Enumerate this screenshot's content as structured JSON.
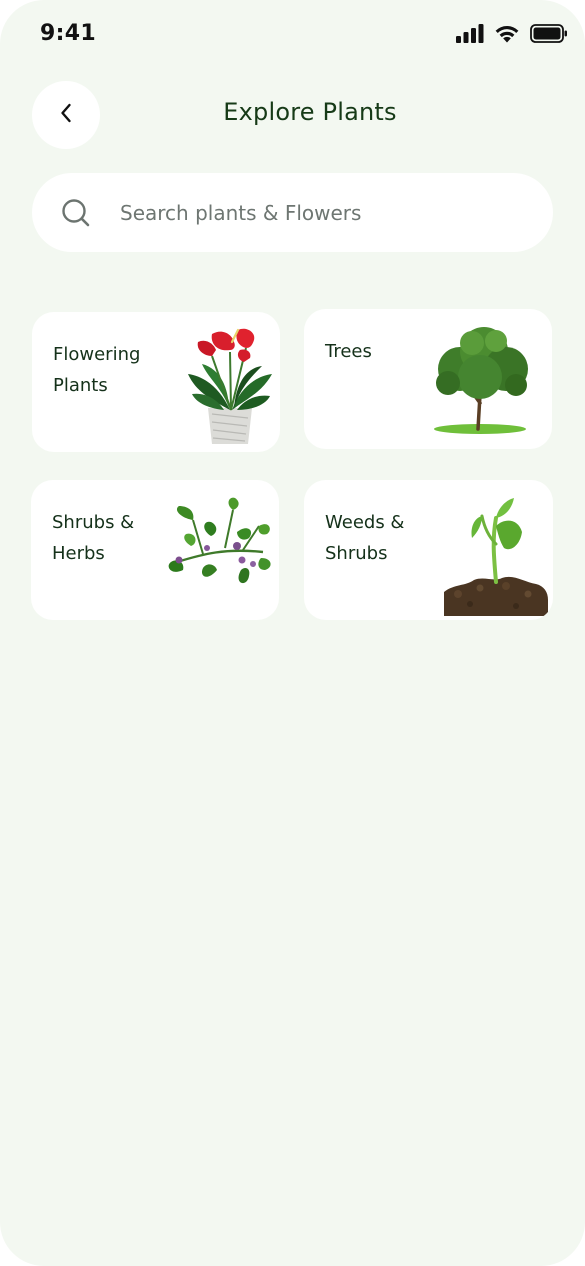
{
  "status_bar": {
    "time": "9:41",
    "icons": [
      "cellular-signal-icon",
      "wifi-icon",
      "battery-icon"
    ]
  },
  "header": {
    "back_icon": "chevron-left-icon",
    "title": "Explore Plants"
  },
  "search": {
    "icon": "search-icon",
    "placeholder": "Search plants & Flowers",
    "value": ""
  },
  "categories": [
    {
      "label": "Flowering Plants",
      "image": "potted-anthurium-image"
    },
    {
      "label": "Trees",
      "image": "tree-image"
    },
    {
      "label": "Shrubs & Herbs",
      "image": "herb-sprig-image"
    },
    {
      "label": "Weeds & Shrubs",
      "image": "seedling-in-soil-image"
    }
  ],
  "colors": {
    "background": "#f3f8f1",
    "card": "#ffffff",
    "title_text": "#163a17",
    "body_text": "#15311a",
    "placeholder_text": "#6e7672"
  }
}
